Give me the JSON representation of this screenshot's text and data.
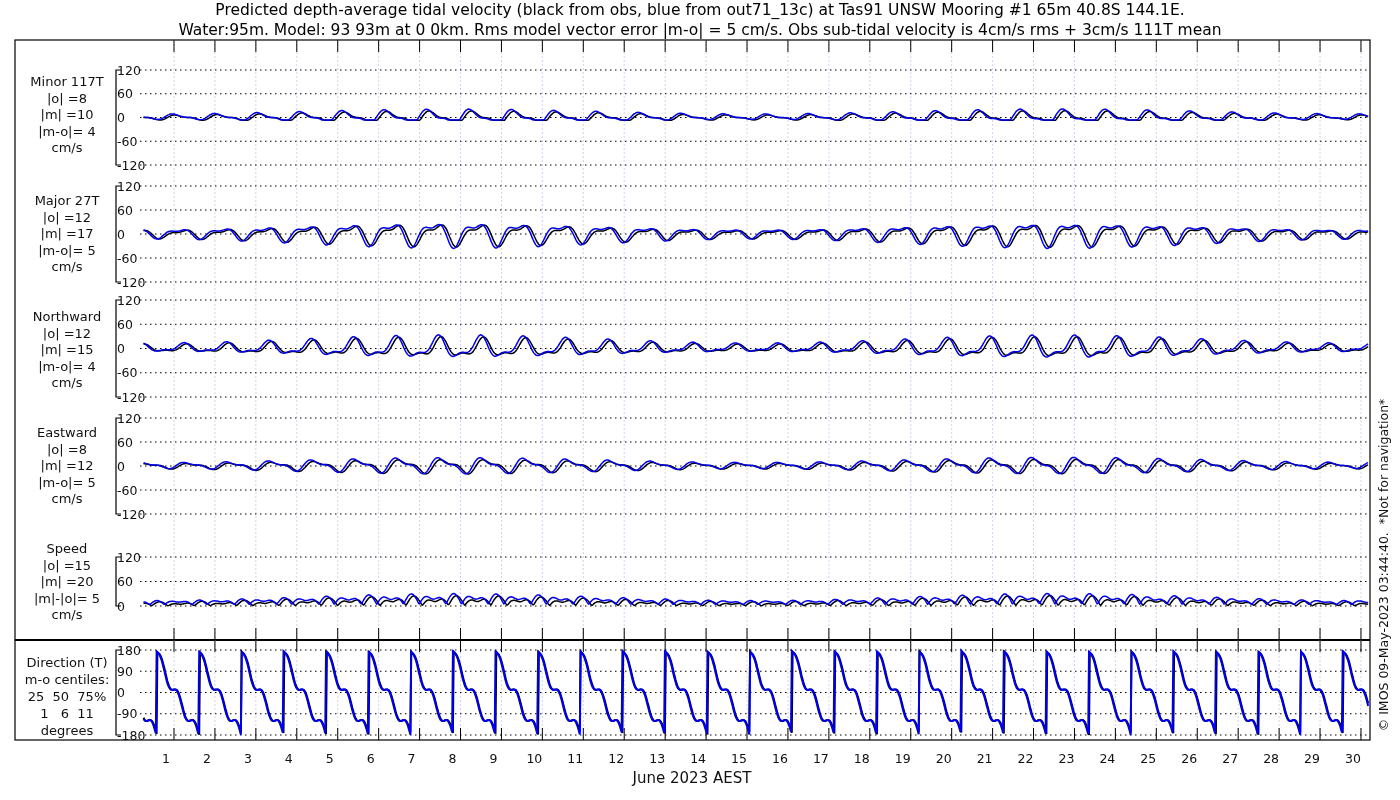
{
  "title_lines": [
    "Predicted depth-average tidal velocity (black from obs, blue from out71_13c) at Tas91 UNSW Mooring #1 65m 40.8S 144.1E.",
    "Water:95m. Model: 93 93m at 0 0km. Rms model vector error |m-o| = 5 cm/s. Obs sub-tidal velocity is 4cm/s rms + 3cm/s 111T mean"
  ],
  "panels": [
    {
      "kind": "velocity",
      "label_lines": [
        "Minor 117T",
        "|o| =8",
        "|m| =10",
        "|m-o|= 4",
        "cm/s"
      ],
      "yticks": [
        "120",
        "60",
        "0",
        "-60",
        "-120"
      ]
    },
    {
      "kind": "velocity",
      "label_lines": [
        "Major 27T",
        "|o| =12",
        "|m| =17",
        "|m-o|= 5",
        "cm/s"
      ],
      "yticks": [
        "120",
        "60",
        "0",
        "-60",
        "-120"
      ]
    },
    {
      "kind": "velocity",
      "label_lines": [
        "Northward",
        "|o| =12",
        "|m| =15",
        "|m-o|= 4",
        "cm/s"
      ],
      "yticks": [
        "120",
        "60",
        "0",
        "-60",
        "-120"
      ]
    },
    {
      "kind": "velocity",
      "label_lines": [
        "Eastward",
        "|o| =8",
        "|m| =12",
        "|m-o|= 5",
        "cm/s"
      ],
      "yticks": [
        "120",
        "60",
        "0",
        "-60",
        "-120"
      ]
    },
    {
      "kind": "speed",
      "label_lines": [
        "Speed",
        "|o| =15",
        "|m| =20",
        "|m|-|o|= 5",
        "cm/s"
      ],
      "yticks": [
        "120",
        "60",
        "0"
      ]
    },
    {
      "kind": "direction",
      "label_lines": [
        "Direction (T)",
        "m-o centiles:",
        "25  50  75%",
        "1   6  11",
        "degrees"
      ],
      "yticks": [
        "180",
        "90",
        "0",
        "-90",
        "-180"
      ]
    }
  ],
  "x_ticks": [
    "1",
    "2",
    "3",
    "4",
    "5",
    "6",
    "7",
    "8",
    "9",
    "10",
    "11",
    "12",
    "13",
    "14",
    "15",
    "16",
    "17",
    "18",
    "19",
    "20",
    "21",
    "22",
    "23",
    "24",
    "25",
    "26",
    "27",
    "28",
    "29",
    "30"
  ],
  "xlabel": "June 2023 AEST",
  "side_note": "© IMOS 09-May-2023 03:44:40.  *Not for navigation*"
}
